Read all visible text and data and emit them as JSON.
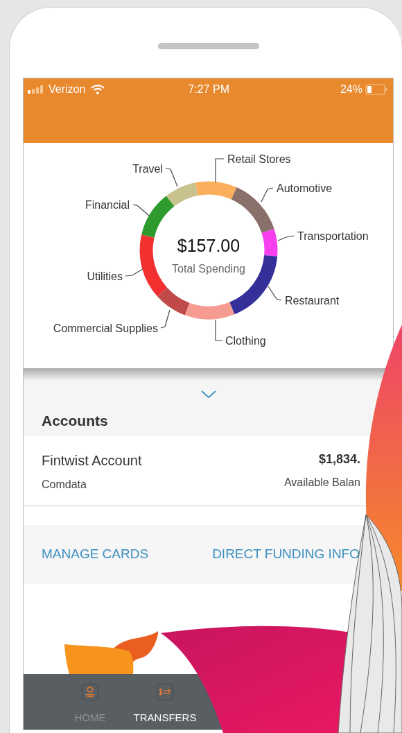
{
  "status_bar": {
    "carrier": "Verizon",
    "time": "7:27 PM",
    "battery": "24%"
  },
  "spending_chart": {
    "total": "$157.00",
    "caption": "Total Spending",
    "categories": [
      {
        "label": "Retail Stores",
        "color": "#fbae5c"
      },
      {
        "label": "Travel",
        "color": "#c8c28e"
      },
      {
        "label": "Automotive",
        "color": "#8a706a"
      },
      {
        "label": "Financial",
        "color": "#2e9a2e"
      },
      {
        "label": "Transportation",
        "color": "#f83ff0"
      },
      {
        "label": "Utilities",
        "color": "#f23030"
      },
      {
        "label": "Restaurant",
        "color": "#33309a"
      },
      {
        "label": "Commercial Supplies",
        "color": "#c04a4a"
      },
      {
        "label": "Clothing",
        "color": "#f59b91"
      }
    ]
  },
  "accounts": {
    "title": "Accounts",
    "items": [
      {
        "name": "Fintwist Account",
        "provider": "Comdata",
        "balance": "$1,834.",
        "balance_label": "Available Balan"
      }
    ]
  },
  "links": [
    "MANAGE CARDS",
    "DIRECT FUNDING INFO"
  ],
  "nav": [
    {
      "kind": "home",
      "label": "HOME",
      "selected": false
    },
    {
      "kind": "transfers",
      "label": "TRANSFERS",
      "selected": true
    }
  ]
}
